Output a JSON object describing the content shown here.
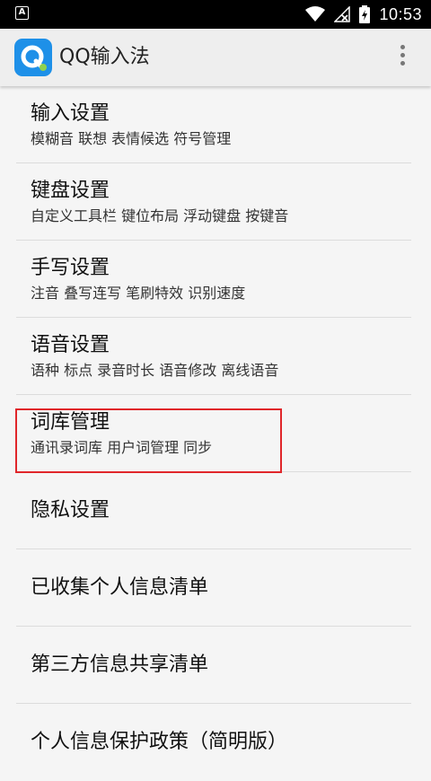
{
  "status_bar": {
    "time": "10:53",
    "notification_icon": "A"
  },
  "app_bar": {
    "title": "QQ输入法",
    "app_icon": "qq-input-app-icon",
    "menu_icon": "more-vert-icon"
  },
  "settings": [
    {
      "title": "输入设置",
      "subtitle": "模糊音 联想 表情候选 符号管理"
    },
    {
      "title": "键盘设置",
      "subtitle": "自定义工具栏 键位布局 浮动键盘 按键音"
    },
    {
      "title": "手写设置",
      "subtitle": "注音 叠写连写 笔刷特效 识别速度"
    },
    {
      "title": "语音设置",
      "subtitle": "语种 标点 录音时长 语音修改 离线语音"
    },
    {
      "title": "词库管理",
      "subtitle": "通讯录词库 用户词管理 同步"
    },
    {
      "title": "隐私设置"
    },
    {
      "title": "已收集个人信息清单"
    },
    {
      "title": "第三方信息共享清单"
    },
    {
      "title": "个人信息保护政策（简明版）"
    }
  ],
  "colors": {
    "highlight": "#e0262a",
    "app_icon": "#1e90e8"
  }
}
